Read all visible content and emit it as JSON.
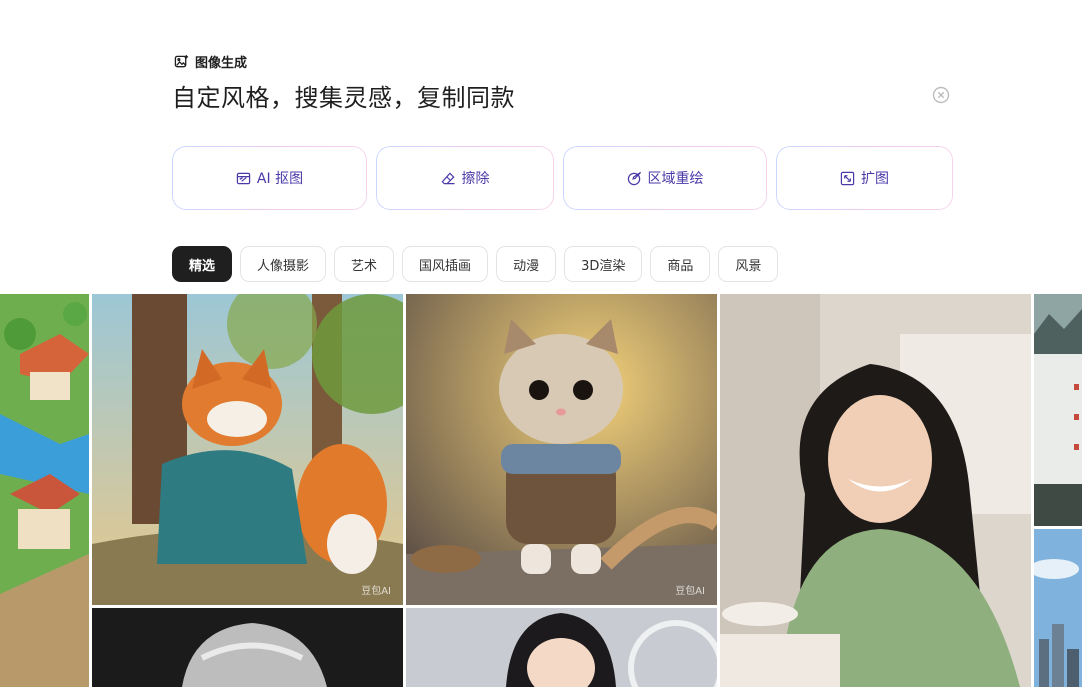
{
  "header": {
    "label": "图像生成",
    "icon": "image-sparkle-icon"
  },
  "prompt": {
    "text": "自定风格，搜集灵感，复制同款",
    "clear_icon": "close-circle-icon"
  },
  "tools": [
    {
      "label": "AI 抠图",
      "icon": "cutout-icon"
    },
    {
      "label": "擦除",
      "icon": "eraser-icon"
    },
    {
      "label": "区域重绘",
      "icon": "brush-icon"
    },
    {
      "label": "扩图",
      "icon": "expand-icon"
    }
  ],
  "tabs": [
    "精选",
    "人像摄影",
    "艺术",
    "国风插画",
    "动漫",
    "3D渲染",
    "商品",
    "风景"
  ],
  "active_tab": "精选",
  "gallery": {
    "watermark": "豆包AI",
    "images": [
      {
        "subject": "isometric-village"
      },
      {
        "subject": "fox-in-hanfu"
      },
      {
        "subject": "knitted-kitten"
      },
      {
        "subject": "smiling-woman-green-sweater"
      },
      {
        "subject": "ink-landscape-poster"
      },
      {
        "subject": "city-skyline"
      },
      {
        "subject": "bw-portrait"
      },
      {
        "subject": "woman-portrait"
      }
    ]
  },
  "colors": {
    "accent": "#4a3aa8",
    "active_tab_bg": "#1f1f1f"
  }
}
